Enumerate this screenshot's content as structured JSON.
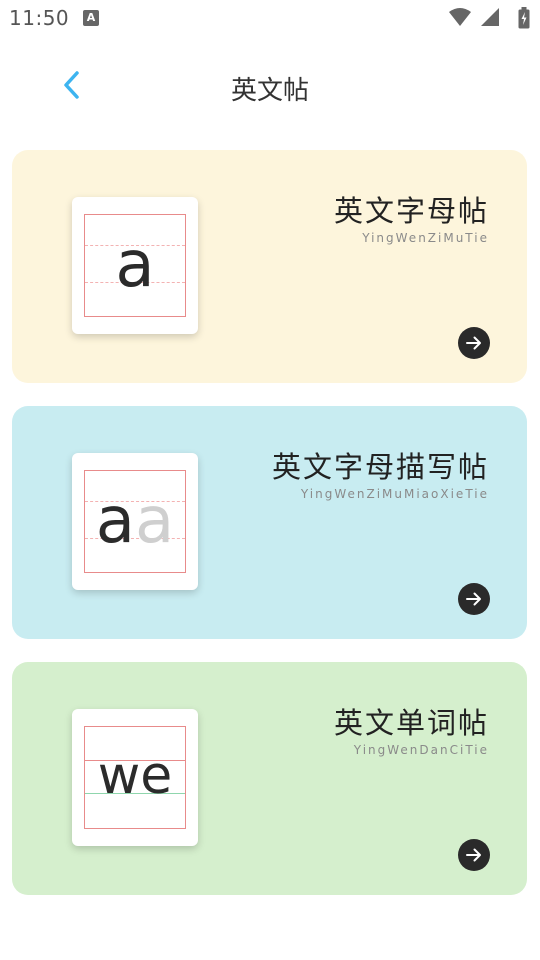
{
  "status_bar": {
    "time": "11:50",
    "notification_badge": "A"
  },
  "header": {
    "title": "英文帖",
    "accent_color": "#3db4f0"
  },
  "cards": [
    {
      "title": "英文字母帖",
      "subtitle": "YingWenZiMuTie",
      "sample": "a",
      "background": "#fdf5dc"
    },
    {
      "title": "英文字母描写帖",
      "subtitle": "YingWenZiMuMiaoXieTie",
      "sample_dark": "a",
      "sample_light": "a",
      "background": "#c8ecf1"
    },
    {
      "title": "英文单词帖",
      "subtitle": "YingWenDanCiTie",
      "sample": "we",
      "background": "#d5efcd"
    }
  ],
  "icons": {
    "back": "chevron-left-icon",
    "go": "arrow-right-icon",
    "wifi": "wifi-icon",
    "signal": "signal-icon",
    "battery": "battery-charging-icon"
  }
}
